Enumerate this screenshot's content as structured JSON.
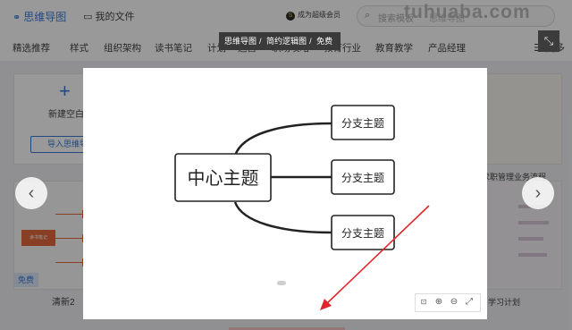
{
  "topbar": {
    "brand_label": "思维导图",
    "my_files_label": "我的文件",
    "vip_label": "成为超级会员",
    "search_placeholder": "搜索模板",
    "search_hint": "思维导图"
  },
  "watermark": "tuhuaba.com",
  "categories": [
    "精选推荐",
    "样式",
    "组织架构",
    "读书笔记",
    "计划",
    "运营",
    "职场攻略",
    "教育行业",
    "教育教学",
    "产品经理"
  ],
  "more_label": "更多",
  "left_cards": {
    "new_blank_label": "新建空白",
    "import_label": "导入思维导图",
    "thumb_center_label": "读书笔记",
    "free_badge": "免费",
    "thumb2_label": "清新2"
  },
  "right_cards": {
    "label1": "求职管理业务流程",
    "label2": "学习计划"
  },
  "breadcrumb": [
    "思维导图",
    "简约逻辑图",
    "免费"
  ],
  "mindmap": {
    "center": "中心主题",
    "branches": [
      "分支主题",
      "分支主题",
      "分支主题"
    ]
  },
  "colors": {
    "brand": "#3a7bd5",
    "arrow": "#e0262b",
    "thumb_accent": "#e46a3b"
  },
  "icons": {
    "close": "collapse-icon",
    "prev": "chevron-left-icon",
    "next": "chevron-right-icon"
  }
}
